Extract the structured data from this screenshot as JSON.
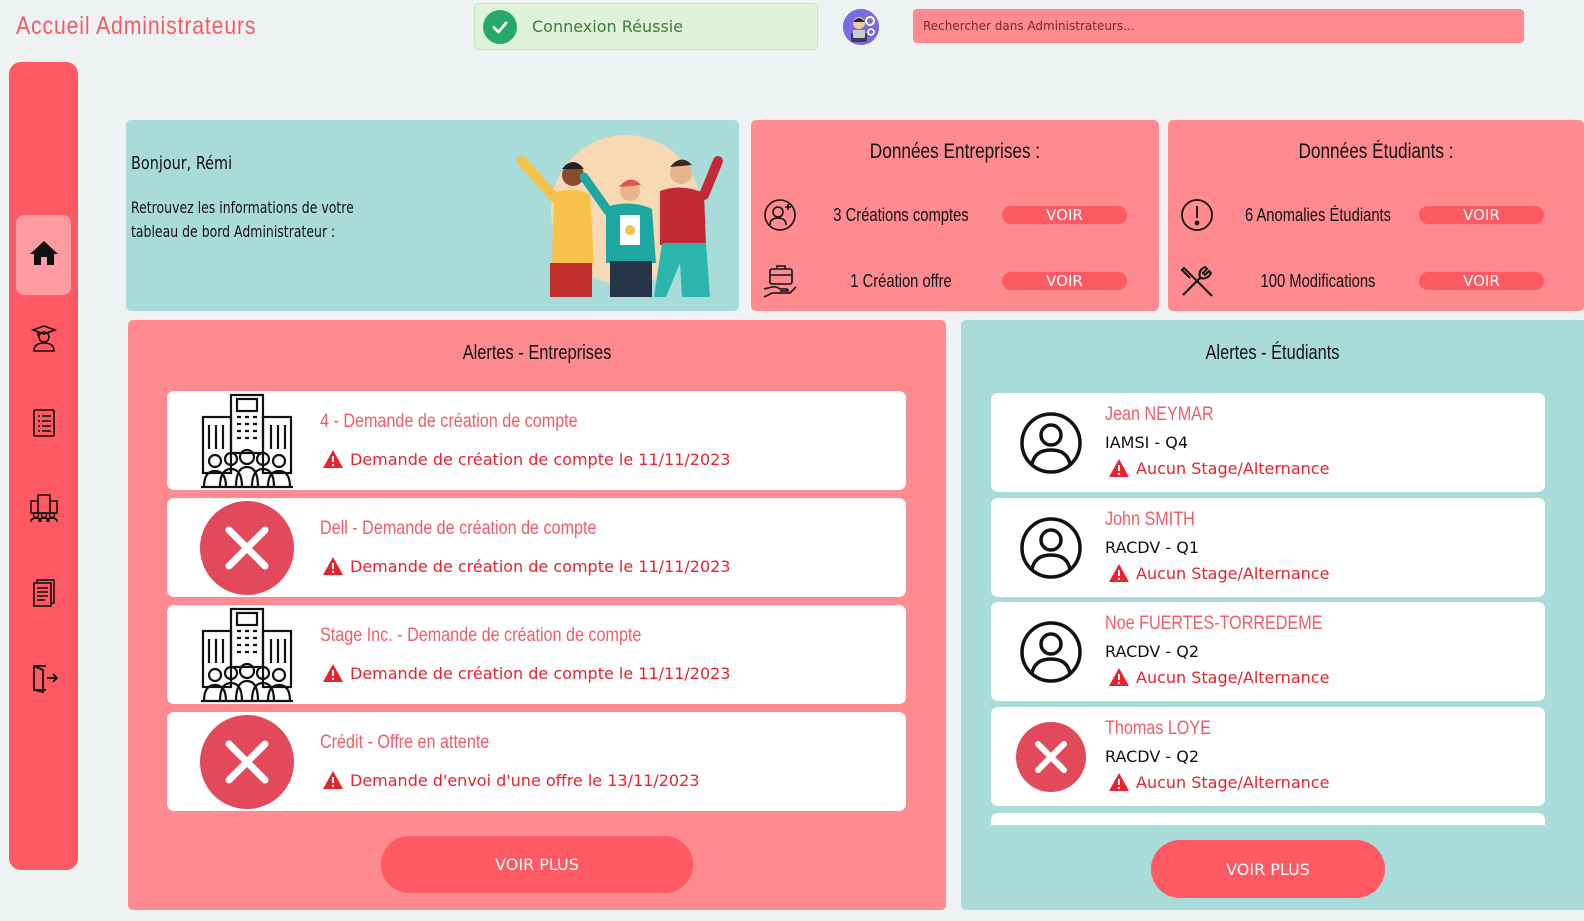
{
  "header": {
    "title": "Accueil Administrateurs",
    "toast": "Connexion Réussie",
    "search_placeholder": "Rechercher dans Administrateurs..."
  },
  "sidebar": {
    "items": [
      {
        "icon": "home-icon",
        "active": true
      },
      {
        "icon": "graduate-icon",
        "active": false
      },
      {
        "icon": "list-document-icon",
        "active": false
      },
      {
        "icon": "company-icon",
        "active": false
      },
      {
        "icon": "document-icon",
        "active": false
      },
      {
        "icon": "logout-icon",
        "active": false
      }
    ]
  },
  "welcome": {
    "greeting": "Bonjour, Rémi",
    "text": "Retrouvez les informations de votre tableau de bord Administrateur :"
  },
  "entreprises_data": {
    "title": "Données Entreprises :",
    "rows": [
      {
        "icon": "add-user-icon",
        "label": "3 Créations comptes",
        "button": "VOIR"
      },
      {
        "icon": "briefcase-hand-icon",
        "label": "1 Création offre",
        "button": "VOIR"
      }
    ]
  },
  "etudiants_data": {
    "title": "Données Étudiants :",
    "rows": [
      {
        "icon": "exclamation-icon",
        "label": "6 Anomalies Étudiants",
        "button": "VOIR"
      },
      {
        "icon": "tools-icon",
        "label": "100 Modifications",
        "button": "VOIR"
      }
    ]
  },
  "alertes_entreprises": {
    "title": "Alertes - Entreprises",
    "items": [
      {
        "icon": "building-icon",
        "heading": "4 - Demande de création de compte",
        "warning": "Demande de création de compte le 11/11/2023"
      },
      {
        "icon": "error-x-icon",
        "heading": "Dell - Demande de création de compte",
        "warning": "Demande de création de compte le 11/11/2023"
      },
      {
        "icon": "building-icon",
        "heading": "Stage Inc. - Demande de création de compte",
        "warning": "Demande de création de compte le 11/11/2023"
      },
      {
        "icon": "error-x-icon",
        "heading": "Crédit - Offre en attente",
        "warning": "Demande d'envoi d'une offre le 13/11/2023"
      }
    ],
    "button": "VOIR PLUS"
  },
  "alertes_etudiants": {
    "title": "Alertes - Étudiants",
    "items": [
      {
        "icon": "user-circle-icon",
        "name": "Jean NEYMAR",
        "group": "IAMSI - Q4",
        "warning": "Aucun Stage/Alternance"
      },
      {
        "icon": "user-circle-icon",
        "name": "John SMITH",
        "group": "RACDV - Q1",
        "warning": "Aucun Stage/Alternance"
      },
      {
        "icon": "user-circle-icon",
        "name": "Noe FUERTES-TORREDEME",
        "group": "RACDV - Q2",
        "warning": "Aucun Stage/Alternance"
      },
      {
        "icon": "error-x-icon",
        "name": "Thomas LOYE",
        "group": "RACDV - Q2",
        "warning": "Aucun Stage/Alternance"
      }
    ],
    "button": "VOIR PLUS"
  },
  "colors": {
    "accent": "#ff5a63",
    "pink_panel": "#ff8a90",
    "teal_panel": "#a9dcd9",
    "alert_text": "#e8232d"
  }
}
